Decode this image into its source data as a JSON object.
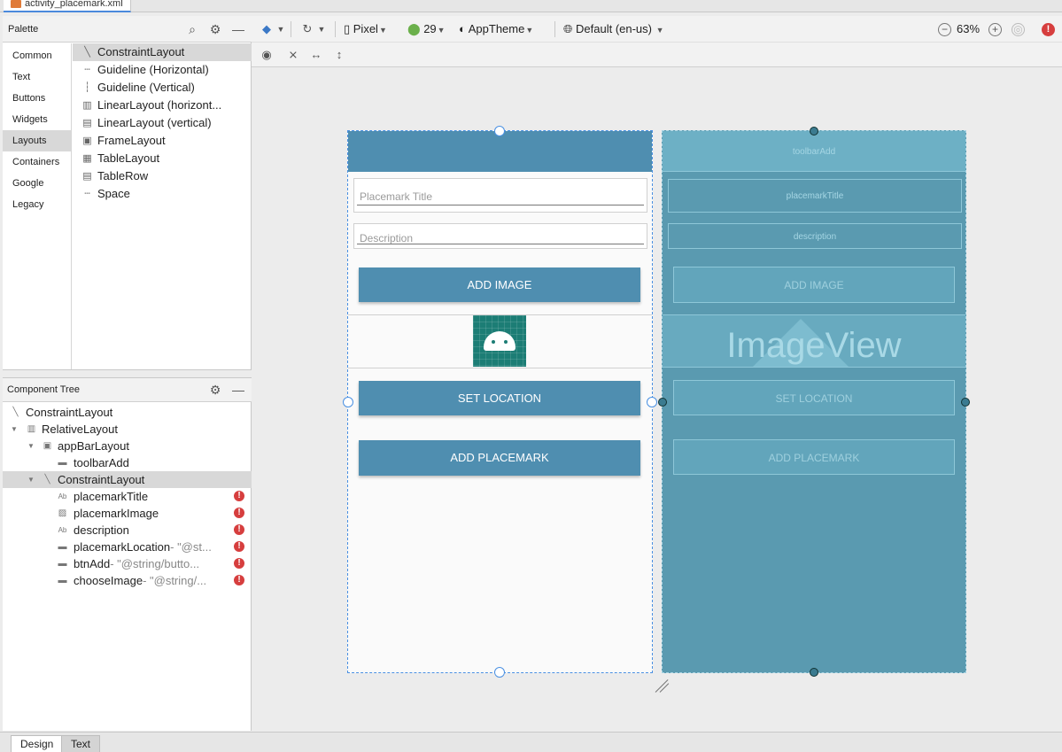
{
  "file_tab": {
    "name": "activity_placemark.xml"
  },
  "palette": {
    "title": "Palette",
    "categories": [
      "Common",
      "Text",
      "Buttons",
      "Widgets",
      "Layouts",
      "Containers",
      "Google",
      "Legacy"
    ],
    "selected_category": "Layouts",
    "items": [
      {
        "label": "ConstraintLayout",
        "icon": "constraint-layout-icon",
        "glyph": "╲"
      },
      {
        "label": "Guideline (Horizontal)",
        "icon": "guideline-horizontal-icon",
        "glyph": "┄"
      },
      {
        "label": "Guideline (Vertical)",
        "icon": "guideline-vertical-icon",
        "glyph": "┆"
      },
      {
        "label": "LinearLayout (horizont...",
        "icon": "linear-horizontal-icon",
        "glyph": "▥"
      },
      {
        "label": "LinearLayout (vertical)",
        "icon": "linear-vertical-icon",
        "glyph": "▤"
      },
      {
        "label": "FrameLayout",
        "icon": "frame-layout-icon",
        "glyph": "▣"
      },
      {
        "label": "TableLayout",
        "icon": "table-layout-icon",
        "glyph": "▦"
      },
      {
        "label": "TableRow",
        "icon": "table-row-icon",
        "glyph": "▤"
      },
      {
        "label": "Space",
        "icon": "space-icon",
        "glyph": "┄"
      }
    ]
  },
  "component_tree": {
    "title": "Component Tree",
    "nodes": [
      {
        "label": "ConstraintLayout",
        "hint": "",
        "icon": "constraint-layout-icon",
        "glyph": "╲",
        "arrow": "",
        "error": false
      },
      {
        "label": "RelativeLayout",
        "hint": "",
        "icon": "relative-layout-icon",
        "glyph": "▥",
        "arrow": "▼",
        "error": false
      },
      {
        "label": "appBarLayout",
        "hint": "",
        "icon": "appbar-layout-icon",
        "glyph": "▣",
        "arrow": "▼",
        "error": false
      },
      {
        "label": "toolbarAdd",
        "hint": "",
        "icon": "toolbar-icon",
        "glyph": "▬",
        "arrow": "",
        "error": false
      },
      {
        "label": "ConstraintLayout",
        "hint": "",
        "icon": "constraint-layout-icon",
        "glyph": "╲",
        "arrow": "▼",
        "error": false
      },
      {
        "label": "placemarkTitle",
        "hint": "",
        "icon": "text-field-icon",
        "glyph": "Ab",
        "arrow": "",
        "error": true
      },
      {
        "label": "placemarkImage",
        "hint": "",
        "icon": "image-view-icon",
        "glyph": "▨",
        "arrow": "",
        "error": true
      },
      {
        "label": "description",
        "hint": "",
        "icon": "text-field-icon",
        "glyph": "Ab",
        "arrow": "",
        "error": true
      },
      {
        "label": "placemarkLocation",
        "hint": "- \"@st...",
        "icon": "button-icon",
        "glyph": "▬",
        "arrow": "",
        "error": true
      },
      {
        "label": "btnAdd",
        "hint": "- \"@string/butto...",
        "icon": "button-icon",
        "glyph": "▬",
        "arrow": "",
        "error": true
      },
      {
        "label": "chooseImage",
        "hint": "- \"@string/...",
        "icon": "button-icon",
        "glyph": "▬",
        "arrow": "",
        "error": true
      }
    ]
  },
  "toolbar": {
    "device": "Pixel",
    "api": "29",
    "theme": "AppTheme",
    "locale": "Default (en-us)",
    "zoom": "63%"
  },
  "design_view": {
    "title_placeholder": "Placemark Title",
    "description_placeholder": "Description",
    "btn_add_image": "ADD IMAGE",
    "btn_set_location": "SET LOCATION",
    "btn_add_placemark": "ADD PLACEMARK"
  },
  "blueprint_view": {
    "toolbar_label": "toolbarAdd",
    "title_label": "placemarkTitle",
    "description_label": "description",
    "btn_add_image": "ADD IMAGE",
    "imageview_label": "ImageView",
    "btn_set_location": "SET LOCATION",
    "btn_add_placemark": "ADD PLACEMARK"
  },
  "bottom_tabs": [
    "Design",
    "Text"
  ],
  "colors": {
    "accent": "#4f8eb0",
    "blueprint": "#5a9ab0",
    "error": "#d63e3e"
  }
}
